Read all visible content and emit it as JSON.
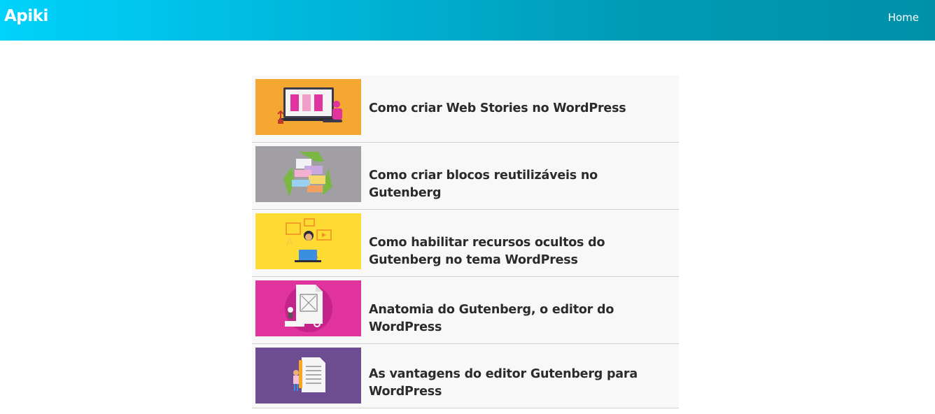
{
  "header": {
    "brand": "Apiki",
    "nav": {
      "home_label": "Home"
    },
    "gradient": [
      "#00d2fb",
      "#0091a8"
    ]
  },
  "posts": [
    {
      "title": "Como criar Web Stories no WordPress",
      "thumb_bg": "#f5a831",
      "thumb_icon": "laptop-web-stories-illustration"
    },
    {
      "title": "Como criar blocos reutilizáveis no Gutenberg",
      "thumb_bg": "#a19fa3",
      "thumb_icon": "recycle-blocks-illustration"
    },
    {
      "title": "Como habilitar recursos ocultos do Gutenberg no tema WordPress",
      "thumb_bg": "#fddb32",
      "thumb_icon": "woman-laptop-illustration"
    },
    {
      "title": "Anatomia do Gutenberg, o editor do WordPress",
      "thumb_bg": "#e0339d",
      "thumb_icon": "document-anatomy-illustration"
    },
    {
      "title": "As vantagens do editor Gutenberg para WordPress",
      "thumb_bg": "#6d4c91",
      "thumb_icon": "person-document-illustration"
    }
  ]
}
